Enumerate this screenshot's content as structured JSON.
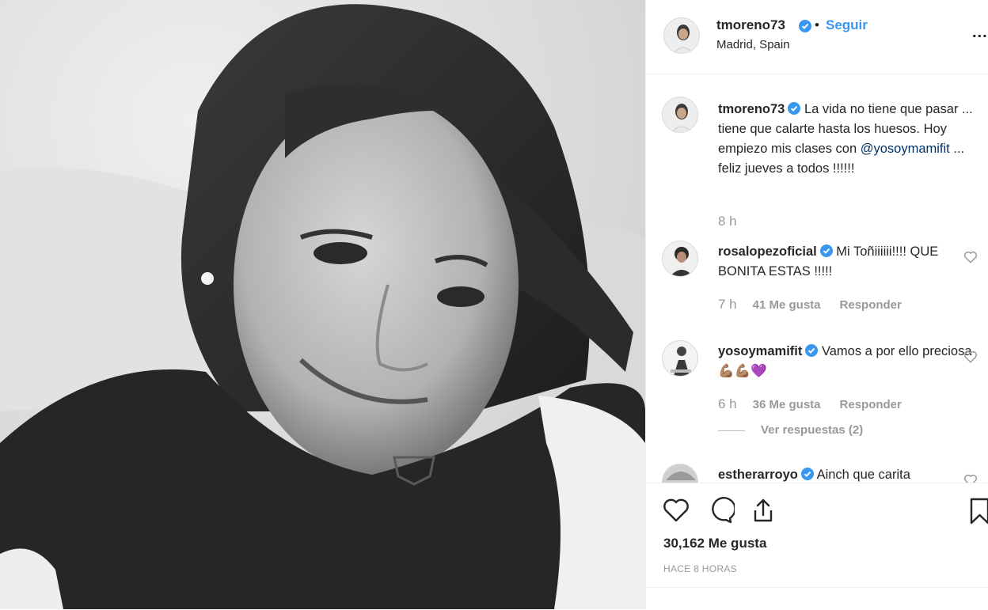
{
  "post": {
    "author": "tmoreno73",
    "follow_label": "Seguir",
    "separator": "•",
    "location": "Madrid, Spain",
    "more_label": "...",
    "caption": {
      "username": "tmoreno73",
      "text_before": "La vida no tiene que pasar ... tiene que calarte hasta los huesos. Hoy empiezo mis clases con ",
      "mention": "@yosoymamifit",
      "text_after": " ... feliz jueves a todos !!!!!!",
      "time": "8 h"
    },
    "comments": [
      {
        "username": "rosalopezoficial",
        "text": "Mi Toñiiiiii!!!! QUE BONITA ESTAS !!!!!",
        "time": "7 h",
        "likes": "41 Me gusta",
        "reply": "Responder"
      },
      {
        "username": "yosoymamifit",
        "text": "Vamos a por ello preciosa💪🏽💪🏽💜",
        "time": "6 h",
        "likes": "36 Me gusta",
        "reply": "Responder",
        "view_replies": "Ver respuestas (2)"
      },
      {
        "username": "estherarroyo",
        "text": "Ainch que carita"
      }
    ],
    "likes_count": "30,162 Me gusta",
    "timestamp": "HACE 8 HORAS"
  },
  "colors": {
    "accent": "#3897f0",
    "verified": "#3897f0",
    "muted": "#999999"
  },
  "icons": {
    "like": "heart-icon",
    "comment": "comment-icon",
    "share": "share-icon",
    "save": "bookmark-icon",
    "verified": "verified-badge-icon",
    "more": "more-options-icon"
  }
}
